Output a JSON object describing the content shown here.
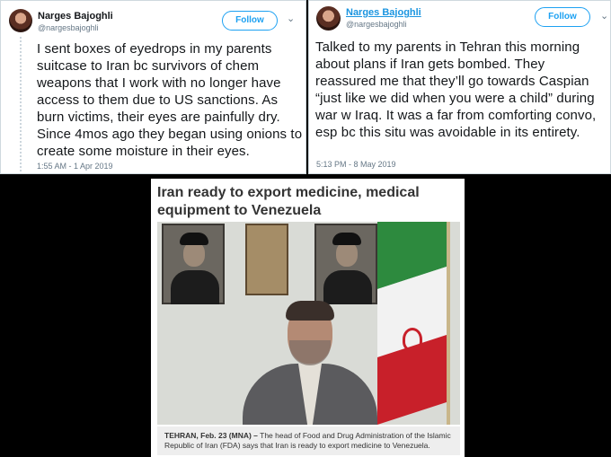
{
  "tweets": [
    {
      "author": "Narges Bajoghli",
      "handle": "@nargesbajoghli",
      "follow_label": "Follow",
      "text": "I sent boxes of eyedrops in my parents suitcase to Iran bc survivors of chem weapons that I work with no longer have access to them due to US sanctions. As burn victims, their eyes are painfully dry. Since 4mos ago they began using onions to create some moisture in their eyes.",
      "timestamp": "1:55 AM - 1 Apr 2019"
    },
    {
      "author": "Narges Bajoghli",
      "handle": "@nargesbajoghli",
      "follow_label": "Follow",
      "text": "Talked to my parents in Tehran this morning about plans if Iran gets bombed. They reassured me that they’ll go towards Caspian “just like we did when you were a child” during war w Iraq. It was a far from comforting convo, esp bc this situ was avoidable in its entirety.",
      "timestamp": "5:13 PM - 8 May 2019"
    }
  ],
  "article": {
    "headline": "Iran ready to export medicine, medical equipment to Venezuela",
    "caption_dateline": "TEHRAN, Feb. 23 (MNA) –",
    "caption_text": "The head of Food and Drug Administration of the Islamic Republic of Iran (FDA) says that Iran is ready to export medicine to Venezuela."
  },
  "icons": {
    "chevron": "chevron-down-icon"
  },
  "colors": {
    "twitter_blue": "#1da1f2",
    "link_blue": "#1b95e0",
    "text": "#14171a",
    "muted": "#657786"
  }
}
